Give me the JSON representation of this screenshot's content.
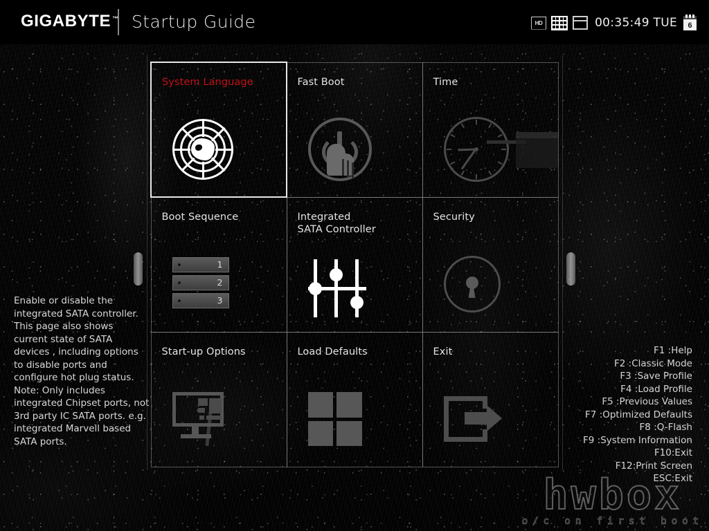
{
  "header": {
    "brand": "GIGABYTE",
    "brand_trademark": "™",
    "title": "Startup Guide",
    "status": {
      "hd_label": "HD",
      "clock": "00:35:49 TUE",
      "calendar_day": "6",
      "icons": [
        "hd-icon",
        "grid-icon",
        "window-icon",
        "calendar-icon"
      ]
    }
  },
  "tiles": [
    {
      "label": "System Language",
      "icon": "globe-icon",
      "selected": true
    },
    {
      "label": "Fast Boot",
      "icon": "power-button-finger-icon",
      "selected": false
    },
    {
      "label": "Time",
      "icon": "analog-clock-icon",
      "selected": false
    },
    {
      "label": "Boot Sequence",
      "icon": "boot-order-list-icon",
      "selected": false
    },
    {
      "label": "Integrated\nSATA Controller",
      "icon": "sliders-icon",
      "selected": false
    },
    {
      "label": "Security",
      "icon": "keyhole-lock-icon",
      "selected": false
    },
    {
      "label": "Start-up Options",
      "icon": "monitor-icon",
      "selected": false
    },
    {
      "label": "Load Defaults",
      "icon": "four-squares-icon",
      "selected": false
    },
    {
      "label": "Exit",
      "icon": "exit-arrow-icon",
      "selected": false
    }
  ],
  "tile_labels": {
    "system_language": "System Language",
    "fast_boot": "Fast Boot",
    "time": "Time",
    "boot_sequence": "Boot Sequence",
    "integrated_sata_line1": "Integrated",
    "integrated_sata_line2": "SATA Controller",
    "security": "Security",
    "startup_options": "Start-up Options",
    "load_defaults": "Load Defaults",
    "exit": "Exit"
  },
  "boot_sequence_items": [
    "1",
    "2",
    "3"
  ],
  "description": {
    "line1": "Enable or disable the integrated SATA controller.",
    "line2": "This page also shows current state of SATA devices , including options to disable ports and configure hot plug status.",
    "line3": "Note: Only includes integrated Chipset ports, not 3rd party IC SATA ports. e.g. integrated Marvell based SATA ports."
  },
  "function_keys": [
    "F1 :Help",
    "F2 :Classic Mode",
    "F3 :Save Profile",
    "F4 :Load Profile",
    "F5 :Previous Values",
    "F7 :Optimized Defaults",
    "F8 :Q-Flash",
    "F9 :System Information",
    "F10:Exit",
    "F12:Print Screen",
    "ESC:Exit"
  ],
  "watermark": {
    "main": "hwbox",
    "subtitle": "o/c on first boot"
  },
  "colors": {
    "selected_label": "#c21118",
    "label": "#e4e4e4",
    "background": "#050505",
    "border": "#969696",
    "selected_border": "#e8e8e8"
  }
}
